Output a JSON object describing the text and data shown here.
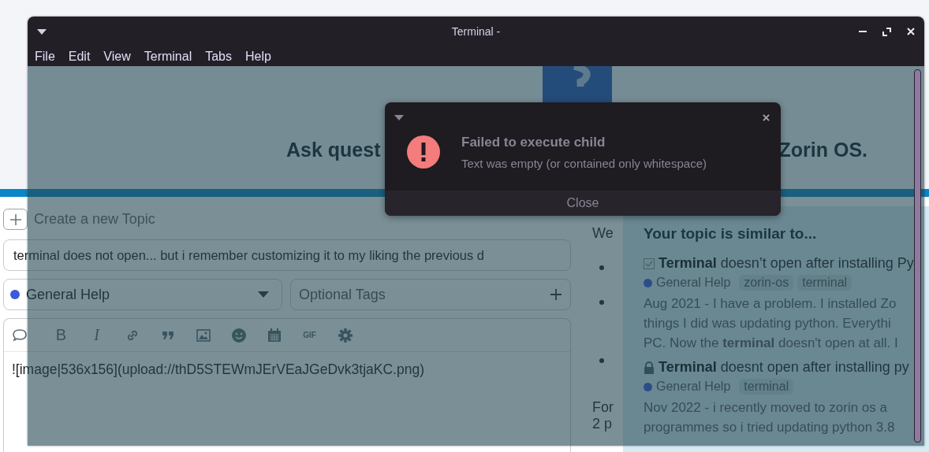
{
  "web_page": {
    "heading_parts": [
      "Ask quest",
      "Zorin OS."
    ],
    "composer": {
      "title": "Create a new Topic",
      "topic_title": {
        "value": "terminal does not open... but i remember customizing it to my liking the previous d"
      },
      "category": {
        "name": "General Help",
        "color": "#3b5bdb"
      },
      "tags": {
        "placeholder": "Optional Tags"
      },
      "toolbar": [
        {
          "kind": "comment"
        },
        {
          "kind": "bold",
          "label": "B"
        },
        {
          "kind": "italic",
          "label": "I"
        },
        {
          "kind": "link"
        },
        {
          "kind": "quote"
        },
        {
          "kind": "image"
        },
        {
          "kind": "emoji"
        },
        {
          "kind": "calendar"
        },
        {
          "kind": "gif",
          "label": "GIF"
        },
        {
          "kind": "gear"
        }
      ],
      "editor_text": "![image|536x156](upload://thD5STEWmJErVEaJGeDvk3tjaKC.png)"
    },
    "guidance": {
      "intro": "We",
      "list_items": [
        {
          "kind": "bullet"
        },
        {
          "kind": "bullet"
        },
        {
          "kind": "bullet"
        }
      ],
      "outro_lines": [
        "For",
        "2 p"
      ]
    },
    "similar_topics": {
      "title": "Your topic is similar to...",
      "topics": [
        {
          "kind": "solved",
          "title": "**Terminal** doesn’t open after installing Py",
          "category": {
            "name": "General Help"
          },
          "tags": [
            "zorin-os",
            "terminal"
          ],
          "excerpt_lines": [
            "Aug 2021 - I have a problem. I installed Zo",
            "things I did was updating python. Everythi",
            "PC. Now the **terminal** doesn't open at all. I"
          ]
        },
        {
          "kind": "closed",
          "title": "**Terminal** doesnt open after installing py",
          "category": {
            "name": "General Help"
          },
          "tags": [
            "terminal"
          ],
          "excerpt_lines": [
            "Nov 2022 - i recently moved to zorin os a",
            "programmes so i tried updating python 3.8"
          ]
        }
      ]
    }
  },
  "terminal": {
    "title": "Terminal -",
    "menu": [
      "File",
      "Edit",
      "View",
      "Terminal",
      "Tabs",
      "Help"
    ]
  },
  "dialog": {
    "title": "Failed to execute child",
    "message": "Text was empty (or contained only whitespace)",
    "button": "Close"
  }
}
